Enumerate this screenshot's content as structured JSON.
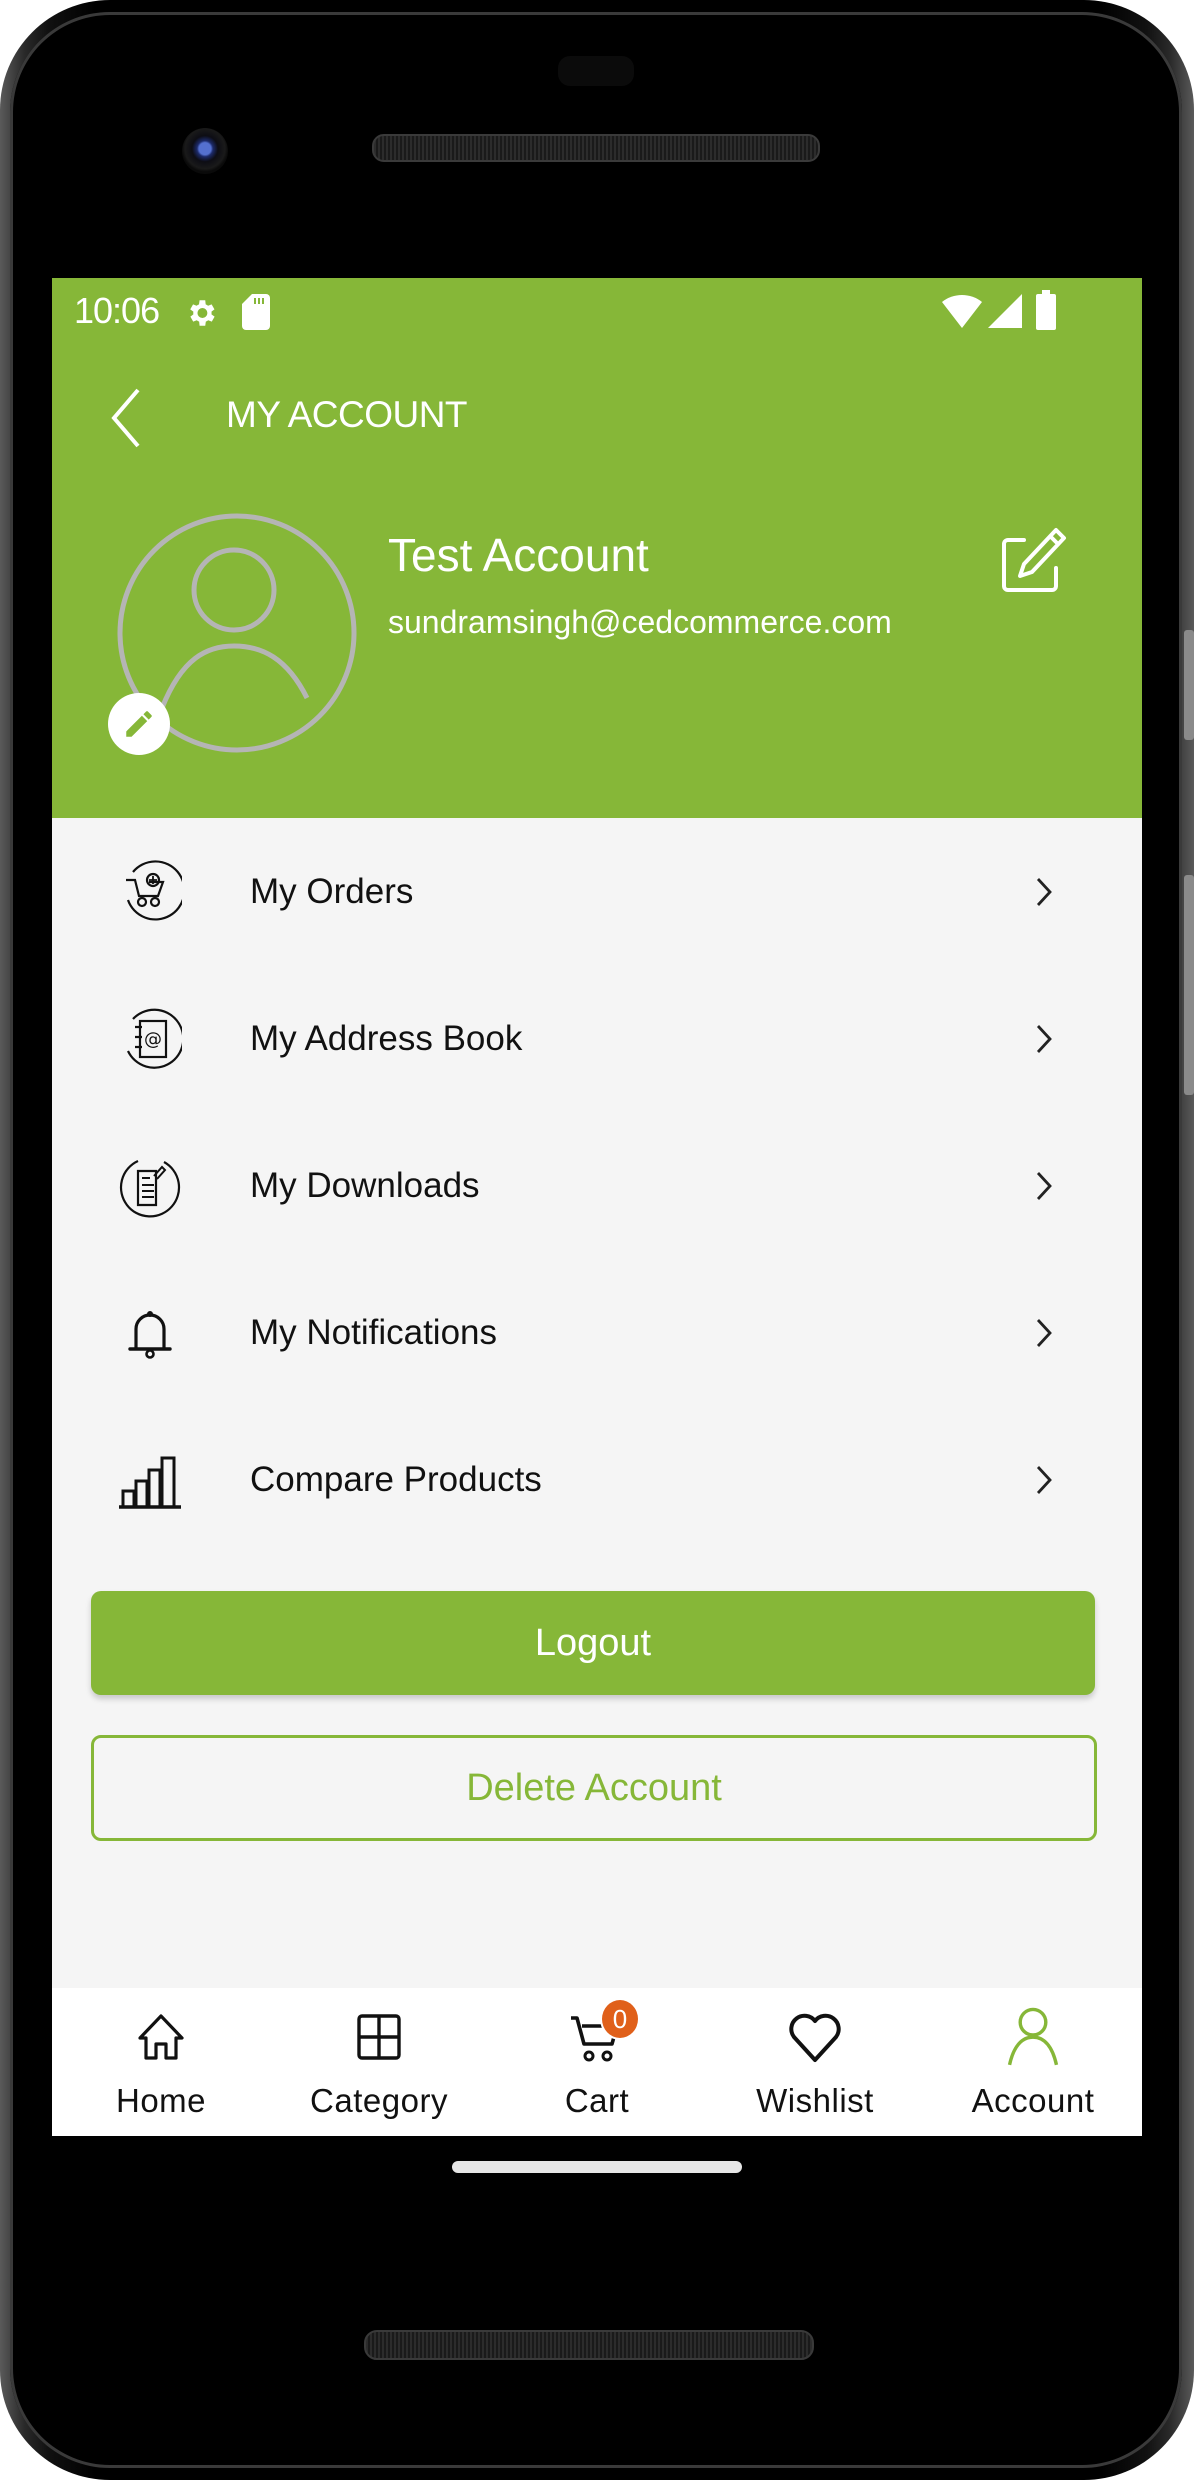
{
  "status_bar": {
    "time": "10:06",
    "left_icons": [
      "gear-icon",
      "sd-card-icon"
    ],
    "right_icons": [
      "wifi-icon",
      "cellular-signal-icon",
      "battery-icon"
    ]
  },
  "toolbar": {
    "title": "MY ACCOUNT",
    "back_icon": "chevron-left-icon"
  },
  "profile": {
    "name": "Test Account",
    "email": "sundramsingh@cedcommerce.com",
    "avatar_icon": "user-avatar-icon",
    "avatar_edit_icon": "pencil-icon",
    "edit_icon": "edit-square-icon"
  },
  "menu": {
    "items": [
      {
        "label": "My Orders",
        "icon": "cart-circle-icon"
      },
      {
        "label": "My Address Book",
        "icon": "address-book-icon"
      },
      {
        "label": "My Downloads",
        "icon": "document-download-icon"
      },
      {
        "label": "My Notifications",
        "icon": "bell-icon"
      },
      {
        "label": "Compare Products",
        "icon": "bar-chart-icon"
      }
    ]
  },
  "actions": {
    "logout_label": "Logout",
    "delete_label": "Delete Account"
  },
  "bottom_nav": {
    "items": [
      {
        "label": "Home",
        "icon": "home-icon"
      },
      {
        "label": "Category",
        "icon": "grid-icon"
      },
      {
        "label": "Cart",
        "icon": "cart-icon"
      },
      {
        "label": "Wishlist",
        "icon": "heart-icon"
      },
      {
        "label": "Account",
        "icon": "user-icon"
      }
    ],
    "active": "Account",
    "cart_badge": "0"
  },
  "colors": {
    "brand": "#86b738",
    "badge": "#e0601a",
    "background": "#f5f5f5"
  }
}
